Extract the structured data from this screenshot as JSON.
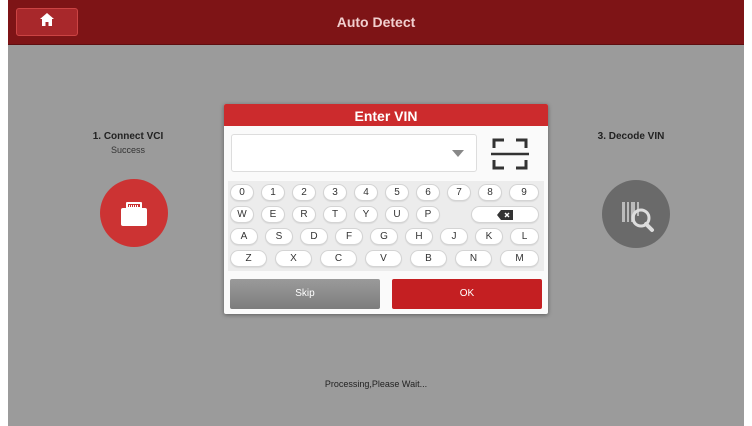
{
  "header": {
    "title": "Auto Detect",
    "home_icon": "home-icon"
  },
  "steps": {
    "connect": {
      "title": "1. Connect VCI",
      "status": "Success",
      "icon": "vci-connector-icon"
    },
    "decode": {
      "title": "3. Decode VIN",
      "icon": "barcode-search-icon"
    }
  },
  "status_text": "Processing,Please Wait...",
  "dialog": {
    "title": "Enter VIN",
    "vin_value": "",
    "vin_placeholder": "",
    "scan_icon": "scan-icon",
    "keyboard": {
      "row1": [
        "0",
        "1",
        "2",
        "3",
        "4",
        "5",
        "6",
        "7",
        "8",
        "9"
      ],
      "row2": [
        "W",
        "E",
        "R",
        "T",
        "Y",
        "U",
        "P"
      ],
      "row3": [
        "A",
        "S",
        "D",
        "F",
        "G",
        "H",
        "J",
        "K",
        "L"
      ],
      "row4": [
        "Z",
        "X",
        "C",
        "V",
        "B",
        "N",
        "M"
      ],
      "backspace_icon": "backspace-icon"
    },
    "skip_label": "Skip",
    "ok_label": "OK"
  },
  "colors": {
    "accent": "#cc2b2d",
    "topbar": "#7e1416",
    "background": "#9b9b9b"
  }
}
